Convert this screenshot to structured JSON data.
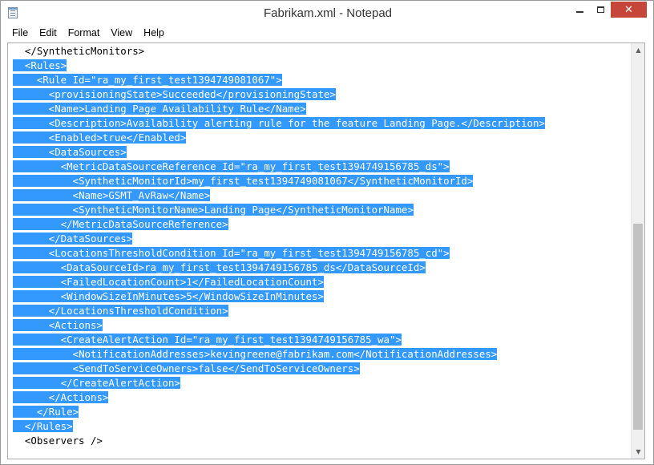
{
  "window": {
    "title": "Fabrikam.xml - Notepad",
    "close_glyph": "✕"
  },
  "menu": {
    "items": [
      "File",
      "Edit",
      "Format",
      "View",
      "Help"
    ]
  },
  "editor": {
    "selection_color": "#3399ff",
    "lines": [
      {
        "text": "</SyntheticMonitors>",
        "indent": 2,
        "selected": false
      },
      {
        "text": "<Rules>",
        "indent": 2,
        "selected": true
      },
      {
        "text": "<Rule Id=\"ra_my_first_test1394749081067\">",
        "indent": 4,
        "selected": true
      },
      {
        "text": "<provisioningState>Succeeded</provisioningState>",
        "indent": 6,
        "selected": true
      },
      {
        "text": "<Name>Landing Page Availability Rule</Name>",
        "indent": 6,
        "selected": true
      },
      {
        "text": "<Description>Availability alerting rule for the feature Landing Page.</Description>",
        "indent": 6,
        "selected": true
      },
      {
        "text": "<Enabled>true</Enabled>",
        "indent": 6,
        "selected": true
      },
      {
        "text": "<DataSources>",
        "indent": 6,
        "selected": true
      },
      {
        "text": "<MetricDataSourceReference Id=\"ra_my_first_test1394749156785_ds\">",
        "indent": 8,
        "selected": true
      },
      {
        "text": "<SyntheticMonitorId>my_first_test1394749081067</SyntheticMonitorId>",
        "indent": 10,
        "selected": true
      },
      {
        "text": "<Name>GSMT_AvRaw</Name>",
        "indent": 10,
        "selected": true
      },
      {
        "text": "<SyntheticMonitorName>Landing Page</SyntheticMonitorName>",
        "indent": 10,
        "selected": true
      },
      {
        "text": "</MetricDataSourceReference>",
        "indent": 8,
        "selected": true
      },
      {
        "text": "</DataSources>",
        "indent": 6,
        "selected": true
      },
      {
        "text": "<LocationsThresholdCondition Id=\"ra_my_first_test1394749156785_cd\">",
        "indent": 6,
        "selected": true
      },
      {
        "text": "<DataSourceId>ra_my_first_test1394749156785_ds</DataSourceId>",
        "indent": 8,
        "selected": true
      },
      {
        "text": "<FailedLocationCount>1</FailedLocationCount>",
        "indent": 8,
        "selected": true
      },
      {
        "text": "<WindowSizeInMinutes>5</WindowSizeInMinutes>",
        "indent": 8,
        "selected": true
      },
      {
        "text": "</LocationsThresholdCondition>",
        "indent": 6,
        "selected": true
      },
      {
        "text": "<Actions>",
        "indent": 6,
        "selected": true
      },
      {
        "text": "<CreateAlertAction Id=\"ra_my_first_test1394749156785_wa\">",
        "indent": 8,
        "selected": true
      },
      {
        "text": "<NotificationAddresses>kevingreene@fabrikam.com</NotificationAddresses>",
        "indent": 10,
        "selected": true
      },
      {
        "text": "<SendToServiceOwners>false</SendToServiceOwners>",
        "indent": 10,
        "selected": true
      },
      {
        "text": "</CreateAlertAction>",
        "indent": 8,
        "selected": true
      },
      {
        "text": "</Actions>",
        "indent": 6,
        "selected": true
      },
      {
        "text": "</Rule>",
        "indent": 4,
        "selected": true
      },
      {
        "text": "</Rules>",
        "indent": 2,
        "selected": true
      },
      {
        "text": "<Observers />",
        "indent": 2,
        "selected": false
      }
    ]
  },
  "scrollbar": {
    "up_glyph": "▲",
    "down_glyph": "▼",
    "thumb_start_fraction": 0.43,
    "thumb_end_fraction": 0.96
  }
}
